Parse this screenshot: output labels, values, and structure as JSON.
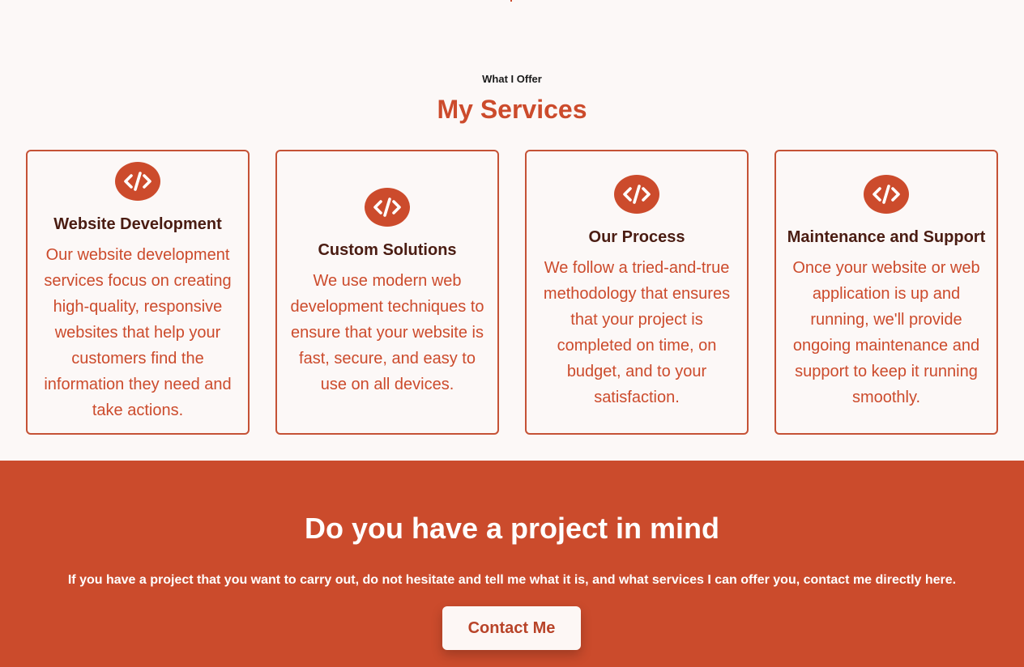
{
  "services_section": {
    "eyebrow": "What I Offer",
    "title": "My Services",
    "accent_color": "#cc4b2c",
    "cards": [
      {
        "icon": "code-icon",
        "title": "Website Development",
        "text": "Our website development services focus on creating high-quality, responsive websites that help your customers find the information they need and take actions."
      },
      {
        "icon": "code-icon",
        "title": "Custom Solutions",
        "text": "We use modern web development techniques to ensure that your website is fast, secure, and easy to use on all devices."
      },
      {
        "icon": "code-icon",
        "title": "Our Process",
        "text": "We follow a tried-and-true methodology that ensures that your project is completed on time, on budget, and to your satisfaction."
      },
      {
        "icon": "code-icon",
        "title": "Maintenance and Support",
        "text": "Once your website or web application is up and running, we'll provide ongoing maintenance and support to keep it running smoothly."
      }
    ]
  },
  "cta_section": {
    "title": "Do you have a project in mind",
    "text": "If you have a project that you want to carry out, do not hesitate and tell me what it is, and what services I can offer you, contact me directly here.",
    "button_label": "Contact Me",
    "background_color": "#cb4b2c"
  }
}
